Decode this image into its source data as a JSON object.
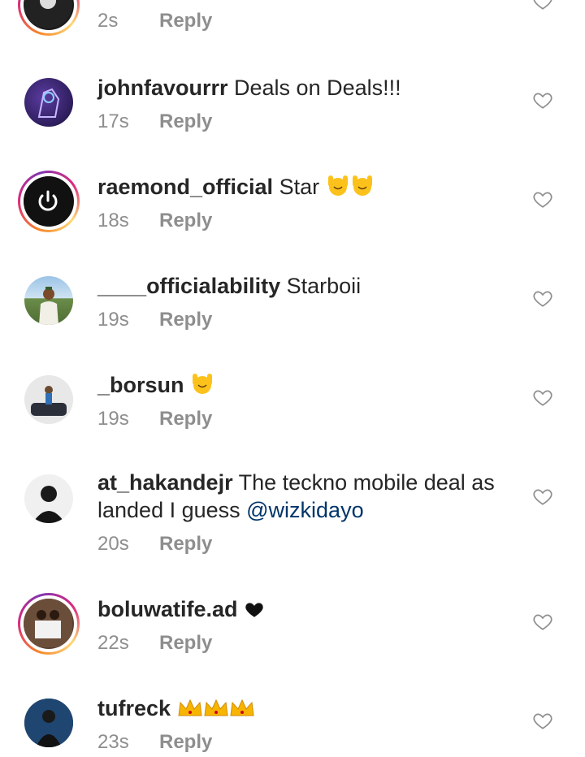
{
  "comments": [
    {
      "username": "",
      "text": "",
      "time": "2s",
      "reply": "Reply"
    },
    {
      "username": "johnfavourrr",
      "text": " Deals on Deals!!!",
      "time": "17s",
      "reply": "Reply"
    },
    {
      "username": "raemond_official",
      "text": " Star",
      "time": "18s",
      "reply": "Reply"
    },
    {
      "username": "____officialability",
      "text": " Starboii",
      "time": "19s",
      "reply": "Reply"
    },
    {
      "username": "_borsun",
      "text": " ",
      "time": "19s",
      "reply": "Reply"
    },
    {
      "username": "at_hakandejr",
      "text": " The teckno mobile deal as landed I guess ",
      "mention": "@wizkidayo",
      "time": "20s",
      "reply": "Reply"
    },
    {
      "username": "boluwatife.ad",
      "text": " ",
      "time": "22s",
      "reply": "Reply"
    },
    {
      "username": "tufreck",
      "text": " ",
      "time": "23s",
      "reply": "Reply"
    }
  ],
  "colors": {
    "ring_orange": "#f58529",
    "ring_pink": "#dd2a7b",
    "meta_gray": "#8e8e8e",
    "mention_blue": "#003569"
  },
  "icons": [
    "heart-outline-icon",
    "raised-hands-emoji",
    "crown-emoji",
    "black-heart-emoji",
    "power-icon"
  ]
}
